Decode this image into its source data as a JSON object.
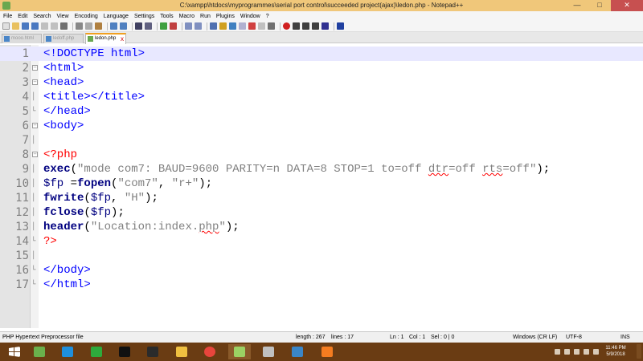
{
  "window": {
    "title": "C:\\xampp\\htdocs\\myprogrammes\\serial port control\\succeeded project(ajax)\\ledon.php - Notepad++",
    "min": "—",
    "max": "□",
    "close": "✕"
  },
  "menu": [
    "File",
    "Edit",
    "Search",
    "View",
    "Encoding",
    "Language",
    "Settings",
    "Tools",
    "Macro",
    "Run",
    "Plugins",
    "Window",
    "?"
  ],
  "tabs": [
    {
      "label": "mooo.html"
    },
    {
      "label": "ledoff.php"
    },
    {
      "label": "ledon.php",
      "close": "x"
    }
  ],
  "editor": {
    "line_numbers": [
      "1",
      "2",
      "3",
      "4",
      "5",
      "6",
      "7",
      "8",
      "9",
      "10",
      "11",
      "12",
      "13",
      "14",
      "15",
      "16",
      "17"
    ],
    "fold_open": "⊟",
    "fold_line": "│",
    "fold_end": "└"
  },
  "status": {
    "filetype": "PHP Hypertext Preprocessor file",
    "length": "length : 267",
    "lines": "lines : 17",
    "ln": "Ln : 1",
    "col": "Col : 1",
    "sel": "Sel : 0 | 0",
    "eol": "Windows (CR LF)",
    "encoding": "UTF-8",
    "ins": "INS"
  },
  "taskbar": {
    "time": "11:46 PM",
    "date": "5/9/2018"
  }
}
